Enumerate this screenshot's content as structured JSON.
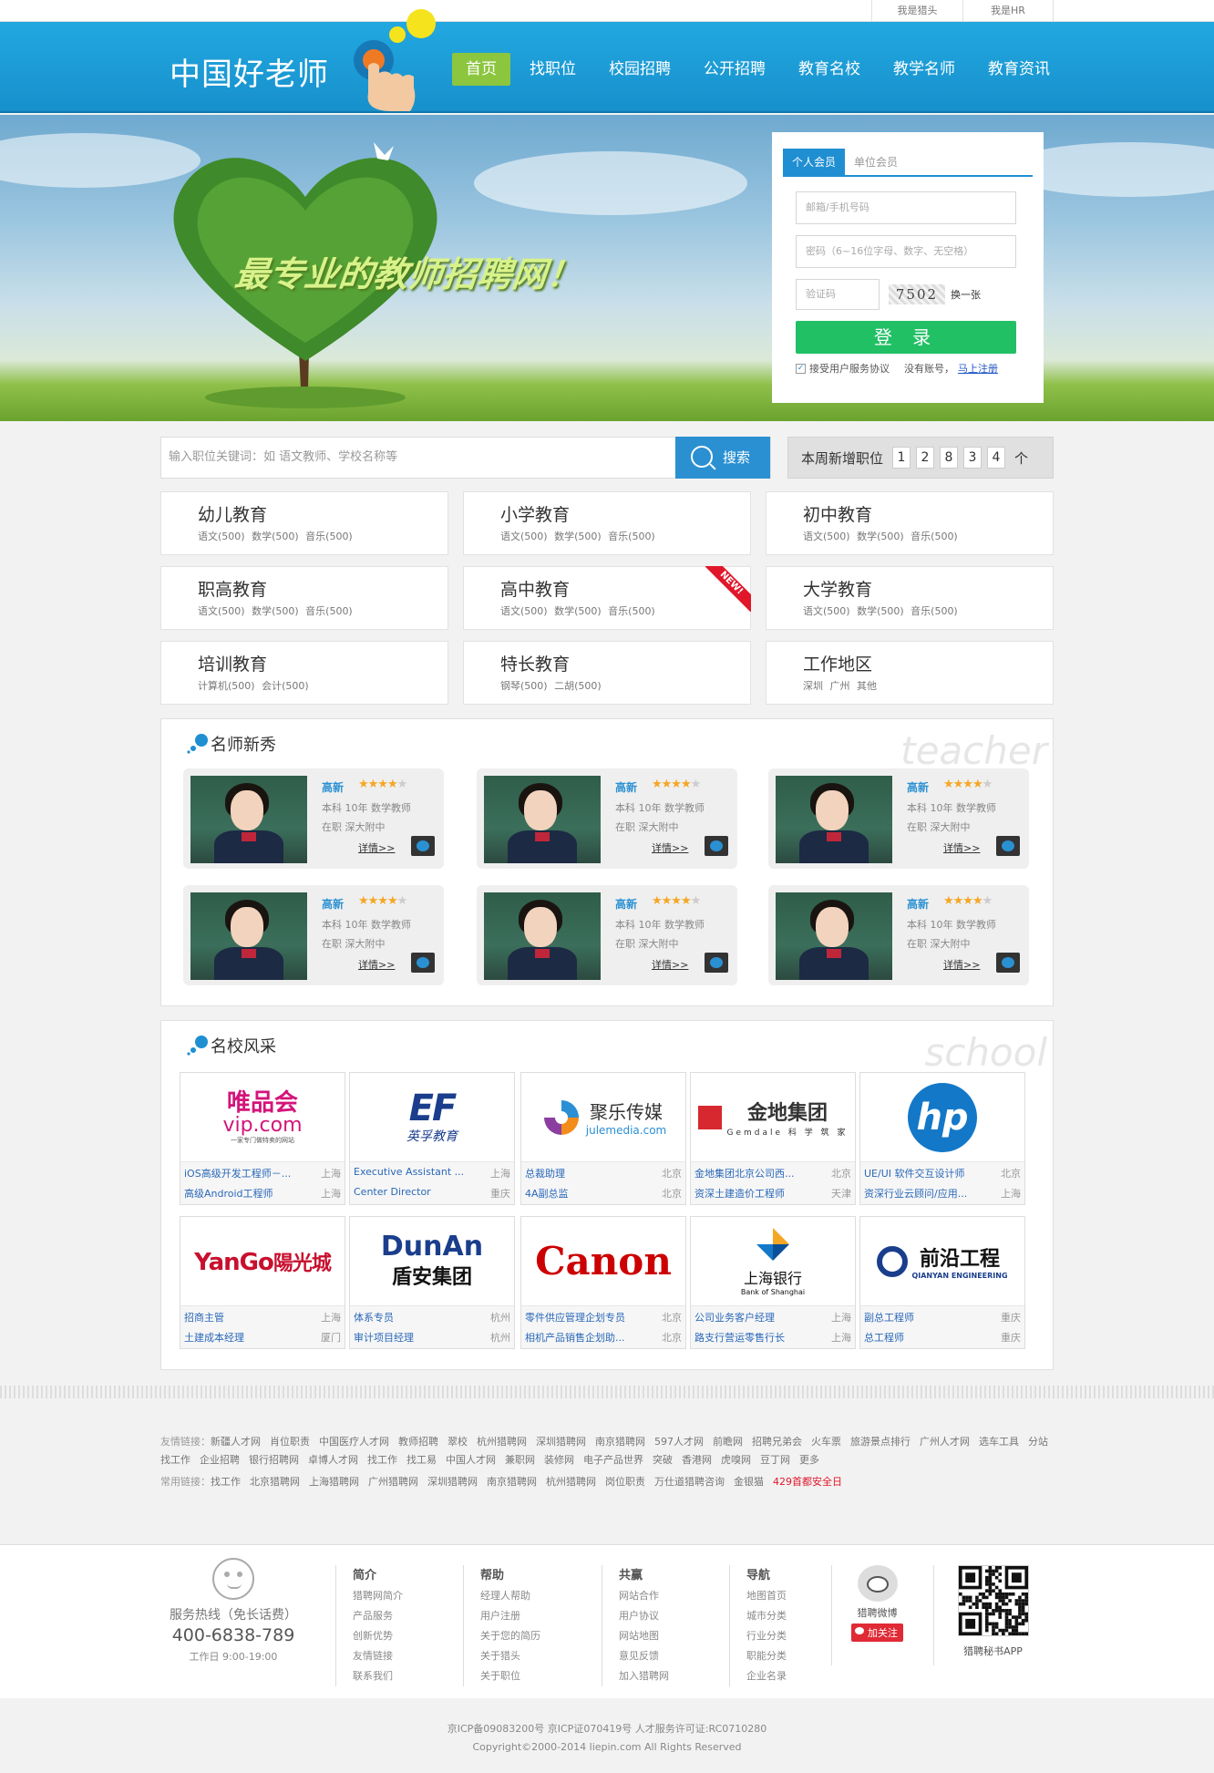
{
  "topbar": {
    "links": [
      "我是猎头",
      "我是HR"
    ]
  },
  "header": {
    "logo": "中国好老师",
    "nav": [
      "首页",
      "找职位",
      "校园招聘",
      "公开招聘",
      "教育名校",
      "教学名师",
      "教育资讯"
    ],
    "active_nav": "首页"
  },
  "banner": {
    "slogan": "最专业的教师招聘网！"
  },
  "login": {
    "tabs": [
      "个人会员",
      "单位会员"
    ],
    "email_placeholder": "邮箱/手机号码",
    "password_placeholder": "密码（6~16位字母、数字、无空格）",
    "captcha_placeholder": "验证码",
    "captcha_text": "7502",
    "refresh": "换一张",
    "submit": "登 录",
    "agree": "接受用户服务协议",
    "no_account": "没有账号，",
    "register": "马上注册"
  },
  "search": {
    "placeholder": "输入职位关键词：如 语文教师、学校名称等",
    "button": "搜索",
    "weekly_label": "本周新增职位",
    "weekly_digits": [
      "1",
      "2",
      "8",
      "3",
      "4"
    ],
    "weekly_unit": "个"
  },
  "categories": [
    {
      "title": "幼儿教育",
      "sub": "语文(500) 数学(500) 音乐(500)"
    },
    {
      "title": "小学教育",
      "sub": "语文(500) 数学(500) 音乐(500)"
    },
    {
      "title": "初中教育",
      "sub": "语文(500) 数学(500) 音乐(500)"
    },
    {
      "title": "职高教育",
      "sub": "语文(500) 数学(500) 音乐(500)"
    },
    {
      "title": "高中教育",
      "sub": "语文(500) 数学(500) 音乐(500)",
      "badge": "NEW!"
    },
    {
      "title": "大学教育",
      "sub": "语文(500) 数学(500) 音乐(500)"
    },
    {
      "title": "培训教育",
      "sub": "计算机(500) 会计(500)"
    },
    {
      "title": "特长教育",
      "sub": "钢琴(500) 二胡(500)"
    },
    {
      "title": "工作地区",
      "sub": "深圳 广州 其他"
    }
  ],
  "teachers": {
    "title": "名师新秀",
    "watermark": "teacher",
    "card": {
      "name": "高新",
      "rating": 4,
      "line2": "本科  10年  数学教师",
      "line3": "在职  深大附中",
      "more": "详情>>"
    }
  },
  "schools": {
    "title": "名校风采",
    "watermark": "school",
    "items": [
      {
        "logo": "唯品会 vip.com",
        "jobs": [
          [
            "iOS高级开发工程师－...",
            "上海"
          ],
          [
            "高级Android工程师",
            "上海"
          ]
        ]
      },
      {
        "logo": "EF 英孚教育",
        "jobs": [
          [
            "Executive Assistant ...",
            "上海"
          ],
          [
            "Center Director",
            "重庆"
          ]
        ]
      },
      {
        "logo": "聚乐传媒 julemedia.com",
        "jobs": [
          [
            "总裁助理",
            "北京"
          ],
          [
            "4A副总监",
            "北京"
          ]
        ]
      },
      {
        "logo": "金地集团 Gemdale",
        "jobs": [
          [
            "金地集团北京公司西...",
            "北京"
          ],
          [
            "资深土建造价工程师",
            "天津"
          ]
        ]
      },
      {
        "logo": "hp",
        "jobs": [
          [
            "UE/UI 软件交互设计师",
            "北京"
          ],
          [
            "资深行业云顾问/应用...",
            "上海"
          ]
        ]
      },
      {
        "logo": "YANGO 阳光城",
        "jobs": [
          [
            "招商主管",
            "上海"
          ],
          [
            "土建成本经理",
            "厦门"
          ]
        ]
      },
      {
        "logo": "DUNAN 盾安集团",
        "jobs": [
          [
            "体系专员",
            "杭州"
          ],
          [
            "审计项目经理",
            "杭州"
          ]
        ]
      },
      {
        "logo": "Canon",
        "jobs": [
          [
            "零件供应管理企划专员",
            "北京"
          ],
          [
            "相机产品销售企划助...",
            "北京"
          ]
        ]
      },
      {
        "logo": "上海银行 Bank of Shanghai",
        "jobs": [
          [
            "公司业务客户经理",
            "上海"
          ],
          [
            "路支行营运零售行长",
            "上海"
          ]
        ]
      },
      {
        "logo": "前沿工程 QIANYAN ENGINEERING",
        "jobs": [
          [
            "副总工程师",
            "重庆"
          ],
          [
            "总工程师",
            "重庆"
          ]
        ]
      }
    ]
  },
  "friend_links": {
    "label": "友情链接：",
    "items": [
      "新疆人才网",
      "肖位职责",
      "中国医疗人才网",
      "教师招聘",
      "翠校",
      "杭州猎聘网",
      "深圳猎聘网",
      "南京猎聘网",
      "597人才网",
      "前瞻网",
      "招聘兄弟会",
      "火车票",
      "旅游景点排行",
      "广州人才网",
      "选车工具",
      "分站找工作",
      "企业招聘",
      "银行招聘网",
      "卓博人才网",
      "找工作",
      "找工易",
      "中国人才网",
      "兼职网",
      "装修网",
      "电子产品世界",
      "突破",
      "香港网",
      "虎嗅网",
      "豆丁网",
      "更多"
    ]
  },
  "common_links": {
    "label": "常用链接：",
    "items": [
      "找工作",
      "北京猎聘网",
      "上海猎聘网",
      "广州猎聘网",
      "深圳猎聘网",
      "南京猎聘网",
      "杭州猎聘网",
      "岗位职责",
      "万仕道猎聘咨询",
      "金银猫"
    ],
    "highlight": "429首都安全日"
  },
  "footer": {
    "service": {
      "label": "服务热线（免长话费）",
      "phone": "400-6838-789",
      "hours": "工作日 9:00-19:00"
    },
    "columns": [
      {
        "title": "简介",
        "items": [
          "猎聘网简介",
          "产品服务",
          "创新优势",
          "友情链接",
          "联系我们"
        ]
      },
      {
        "title": "帮助",
        "items": [
          "经理人帮助",
          "用户注册",
          "关于您的简历",
          "关于猎头",
          "关于职位"
        ]
      },
      {
        "title": "共赢",
        "items": [
          "网站合作",
          "用户协议",
          "网站地图",
          "意见反馈",
          "加入猎聘网"
        ]
      },
      {
        "title": "导航",
        "items": [
          "地图首页",
          "城市分类",
          "行业分类",
          "职能分类",
          "企业名录"
        ]
      }
    ],
    "weibo": "猎聘微博",
    "follow": "加关注",
    "app": "猎聘秘书APP",
    "icp": "京ICP备09083200号 京ICP证070419号 人才服务许可证:RC0710280",
    "copyright": "Copyright©2000-2014 liepin.com All Rights Reserved"
  },
  "colors": {
    "primary": "#1f8fd2",
    "nav_active": "#8cc63f",
    "login_button": "#22c065",
    "badge": "#e0172a"
  }
}
